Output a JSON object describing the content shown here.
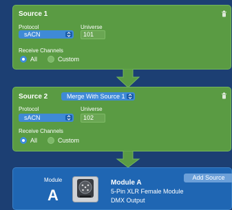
{
  "sources": [
    {
      "title": "Source 1",
      "protocol_label": "Protocol",
      "protocol_value": "sACN",
      "universe_label": "Universe",
      "universe_value": "101",
      "receive_label": "Receive Channels",
      "options": [
        "All",
        "Custom"
      ],
      "selected_option": "All"
    },
    {
      "title": "Source 2",
      "merge_value": "Merge With Source 1",
      "protocol_label": "Protocol",
      "protocol_value": "sACN",
      "universe_label": "Universe",
      "universe_value": "102",
      "receive_label": "Receive Channels",
      "options": [
        "All",
        "Custom"
      ],
      "selected_option": "All"
    }
  ],
  "module": {
    "label": "Module",
    "letter": "A",
    "name": "Module A",
    "description": "5-Pin XLR Female Module",
    "output": "DMX Output",
    "add_source_label": "Add Source"
  },
  "colors": {
    "background": "#1c3f73",
    "source_card": "#5a9b43",
    "module_card": "#1f66b3",
    "accent": "#3e8ddc"
  },
  "icons": {
    "trash": "trash-icon",
    "flow_arrow": "arrow-down-icon",
    "select_chevron": "chevron-updown-icon",
    "module_image": "xlr-connector-icon"
  }
}
